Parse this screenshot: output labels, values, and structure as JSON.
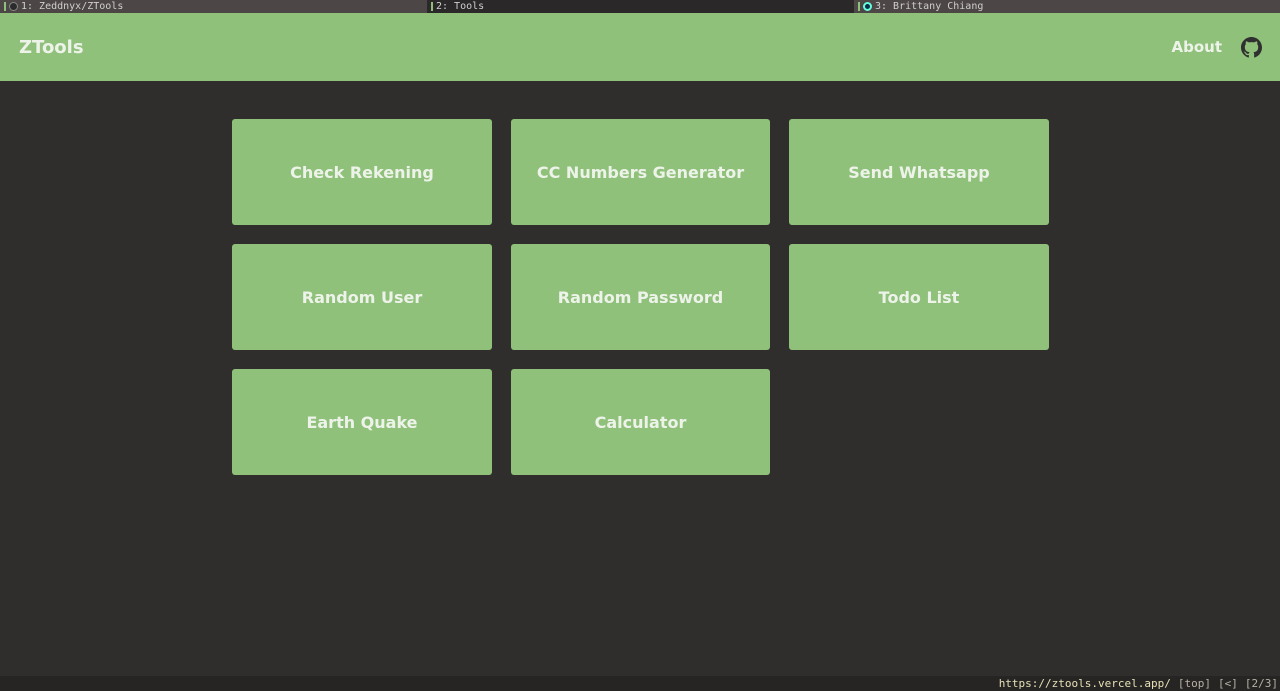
{
  "browser": {
    "tabs": [
      {
        "label": "1: Zeddnyx/ZTools",
        "icon": "github-favicon"
      },
      {
        "label": "2: Tools",
        "icon": ""
      },
      {
        "label": "3: Brittany Chiang",
        "icon": "site-favicon"
      }
    ],
    "status": {
      "url": "https://ztools.vercel.app/",
      "scroll": "[top]",
      "history": "[<]",
      "tab_index": "[2/3]"
    }
  },
  "header": {
    "brand": "ZTools",
    "about_label": "About",
    "github_icon": "github-icon"
  },
  "tools": [
    {
      "label": "Check Rekening"
    },
    {
      "label": "CC Numbers Generator"
    },
    {
      "label": "Send Whatsapp"
    },
    {
      "label": "Random User"
    },
    {
      "label": "Random Password"
    },
    {
      "label": "Todo List"
    },
    {
      "label": "Earth Quake"
    },
    {
      "label": "Calculator"
    }
  ],
  "colors": {
    "accent": "#8fc17b",
    "background": "#302e2c",
    "text": "#eef3ea"
  }
}
